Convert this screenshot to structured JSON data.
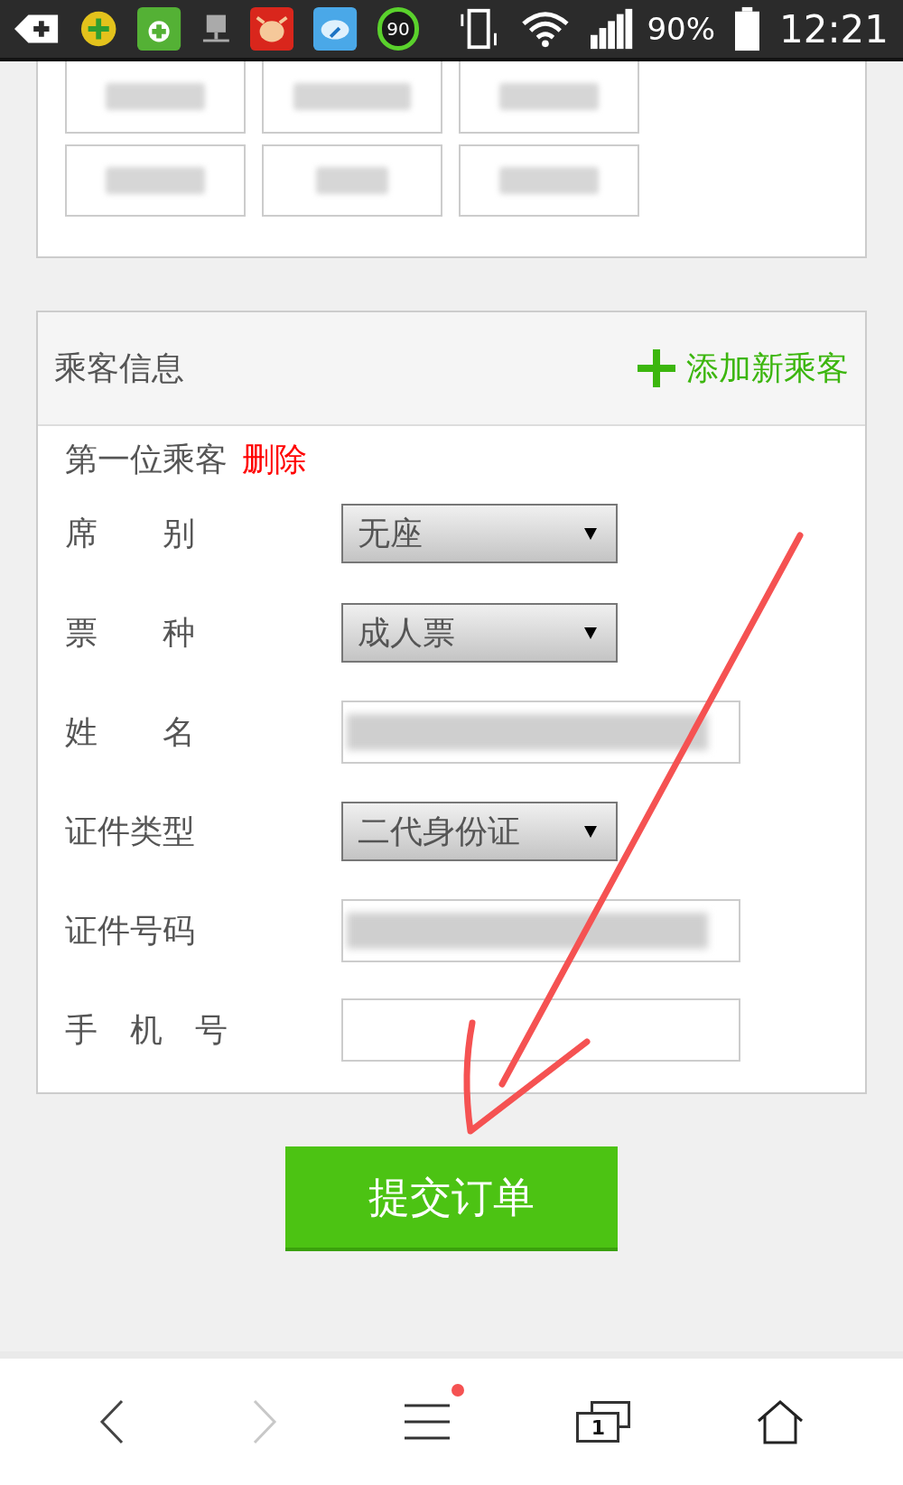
{
  "status_bar": {
    "app_badge": "90",
    "battery": "90%",
    "time": "12:21"
  },
  "passenger_section": {
    "title": "乘客信息",
    "add_link": "添加新乘客",
    "passenger_title": "第一位乘客",
    "delete_link": "删除",
    "fields": [
      {
        "label": "席　　别",
        "kind": "select",
        "value": "无座"
      },
      {
        "label": "票　　种",
        "kind": "select",
        "value": "成人票"
      },
      {
        "label": "姓　　名",
        "kind": "input",
        "obscured": true
      },
      {
        "label": "证件类型",
        "kind": "select",
        "value": "二代身份证"
      },
      {
        "label": "证件号码",
        "kind": "input",
        "obscured": true
      },
      {
        "label": "手　机　号",
        "kind": "input",
        "obscured": false
      }
    ]
  },
  "submit_button": "提交订单",
  "bottom_nav": {
    "forward_disabled": true,
    "menu_notification": true,
    "tab_count": "1"
  }
}
